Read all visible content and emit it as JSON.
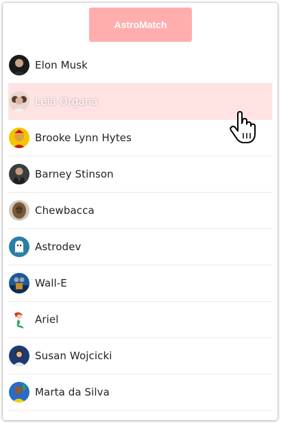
{
  "header": {
    "title": "AstroMatch",
    "color": "#ffadad"
  },
  "hover_highlight_color": "#ffe3e3",
  "profiles": [
    {
      "name": "Elon Musk",
      "avatar_icon": "person-photo-icon"
    },
    {
      "name": "Leia Organa",
      "avatar_icon": "person-photo-icon"
    },
    {
      "name": "Brooke Lynn Hytes",
      "avatar_icon": "person-photo-icon"
    },
    {
      "name": "Barney Stinson",
      "avatar_icon": "person-photo-icon"
    },
    {
      "name": "Chewbacca",
      "avatar_icon": "person-photo-icon"
    },
    {
      "name": "Astrodev",
      "avatar_icon": "ghost-icon"
    },
    {
      "name": "Wall-E",
      "avatar_icon": "robot-photo-icon"
    },
    {
      "name": "Ariel",
      "avatar_icon": "mermaid-icon"
    },
    {
      "name": "Susan Wojcicki",
      "avatar_icon": "person-photo-icon"
    },
    {
      "name": "Marta da Silva",
      "avatar_icon": "person-photo-icon"
    }
  ],
  "cursor_icon": "hand-pointer-icon"
}
